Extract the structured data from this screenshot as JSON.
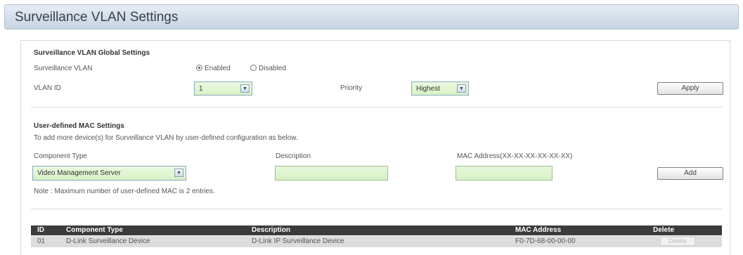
{
  "header": {
    "title": "Surveillance VLAN Settings"
  },
  "global_settings": {
    "section_title": "Surveillance VLAN Global Settings",
    "surveillance_vlan_label": "Surveillance VLAN",
    "enabled_label": "Enabled",
    "disabled_label": "Disabled",
    "selected_state": "Enabled",
    "vlan_id_label": "VLAN ID",
    "vlan_id_value": "1",
    "priority_label": "Priority",
    "priority_value": "Highest",
    "apply_label": "Apply"
  },
  "user_mac": {
    "section_title": "User-defined MAC Settings",
    "instruction": "To add more device(s) for Surveillance VLAN by user-defined configuration as below.",
    "component_type_label": "Component Type",
    "component_type_value": "Video Management Server",
    "description_label": "Description",
    "description_value": "",
    "mac_label": "MAC Address(XX-XX-XX-XX-XX-XX)",
    "mac_value": "",
    "add_label": "Add",
    "note": "Note : Maximum number of user-defined MAC is 2 entries."
  },
  "table": {
    "columns": [
      "ID",
      "Component Type",
      "Description",
      "MAC Address",
      "Delete"
    ],
    "rows": [
      {
        "id": "01",
        "component_type": "D-Link Surveillance Device",
        "description": "D-Link IP Surveillance Device",
        "mac": "F0-7D-68-00-00-00",
        "delete_label": "Delete"
      }
    ]
  },
  "colors": {
    "input_bg": "#d7f2c4",
    "table_header_bg": "#3b3b3b",
    "title_bar_bg": "#c6d3e2"
  }
}
